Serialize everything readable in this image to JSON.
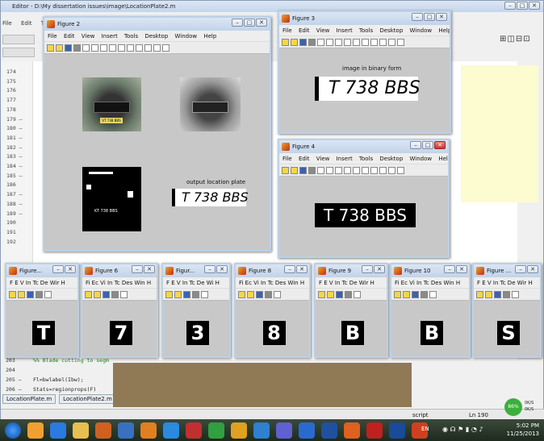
{
  "editor": {
    "title": "Editor - D:\\My dissertation issues\\image\\LocationPlate2.m",
    "menu": [
      "File",
      "Edit",
      "Te"
    ],
    "line_numbers": [
      "174",
      "175",
      "176",
      "177",
      "178",
      "179 –",
      "180 –",
      "181 –",
      "182 –",
      "183 –",
      "184 –",
      "185 –",
      "186",
      "187 –",
      "188 –",
      "189 –",
      "190",
      "191",
      "192"
    ],
    "bottom_lines": [
      {
        "num": "203",
        "text": "%% Blade cutting to segm"
      },
      {
        "num": "204",
        "text": ""
      },
      {
        "num": "205 –",
        "text": "Fl=bwlabel(Ibw);"
      },
      {
        "num": "206 –",
        "text": "Stats=regionprops(F)"
      }
    ],
    "tabs": [
      "LocationPlate.m",
      "LocationPlate2.m"
    ],
    "status_script": "script",
    "status_ln": "Ln  190"
  },
  "fig2": {
    "title": "Figure 2",
    "menu": [
      "File",
      "Edit",
      "View",
      "Insert",
      "Tools",
      "Desktop",
      "Window",
      "Help"
    ],
    "caption": "output location plate",
    "plate_text": "T 738  BBS",
    "small_plate": "KT 738 BBS",
    "car_plate": "VT 738 BBS"
  },
  "fig3": {
    "title": "Figure 3",
    "menu": [
      "File",
      "Edit",
      "View",
      "Insert",
      "Tools",
      "Desktop",
      "Window",
      "Help"
    ],
    "caption": "image in binary form",
    "plate_text": "T 738  BBS"
  },
  "fig4": {
    "title": "Figure 4",
    "menu": [
      "File",
      "Edit",
      "View",
      "Insert",
      "Tools",
      "Desktop",
      "Window",
      "Help"
    ],
    "plate_text": "T 738  BBS"
  },
  "small_figs": [
    {
      "title": "Figure...",
      "menu": "F E V In Tc De Wir H",
      "char": "T"
    },
    {
      "title": "Figure 6",
      "menu": "Fi Ec Vi In Tc Des Win H",
      "char": "7"
    },
    {
      "title": "Figur...",
      "menu": "F E V In Tc De Wi H",
      "char": "3"
    },
    {
      "title": "Figure 8",
      "menu": "Fi Ec Vi In Tc Des Win H",
      "char": "8"
    },
    {
      "title": "Figure 9",
      "menu": "F E V In Tc De Wir H",
      "char": "B"
    },
    {
      "title": "Figure 10",
      "menu": "Fi Ec Vi In Tc Des Win H",
      "char": "B"
    },
    {
      "title": "Figure ...",
      "menu": "F E V In Tc De Wir H",
      "char": "S"
    }
  ],
  "tray": {
    "lang": "EN",
    "time": "5:02 PM",
    "date": "11/25/2013",
    "battery": "86%",
    "speed_up": "0K/S",
    "speed_down": "0K/S"
  }
}
